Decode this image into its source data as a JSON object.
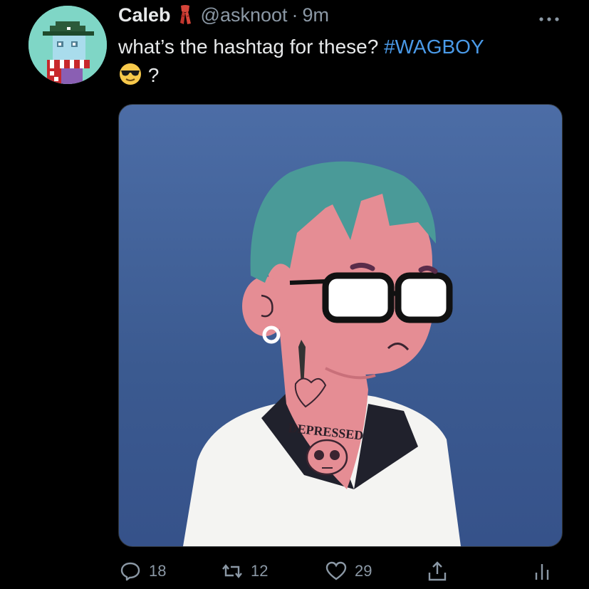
{
  "tweet": {
    "author_name": "Caleb",
    "handle": "@asknoot",
    "separator": "·",
    "time": "9m",
    "text": "what’s the hashtag for these?",
    "hashtag": "#WAGBOY",
    "text_suffix": "?",
    "tattoo_text": "DEPRESSED"
  },
  "icons": {
    "more": "more-icon",
    "reply": "reply-icon",
    "retweet": "retweet-icon",
    "like": "heart-icon",
    "share": "share-icon",
    "analytics": "analytics-icon"
  },
  "stats": {
    "replies": "18",
    "retweets": "12",
    "likes": "29"
  },
  "colors": {
    "background": "#000000",
    "hashtag": "#4a9ae8",
    "muted": "#8b98a5",
    "text": "#e7e9ea"
  }
}
